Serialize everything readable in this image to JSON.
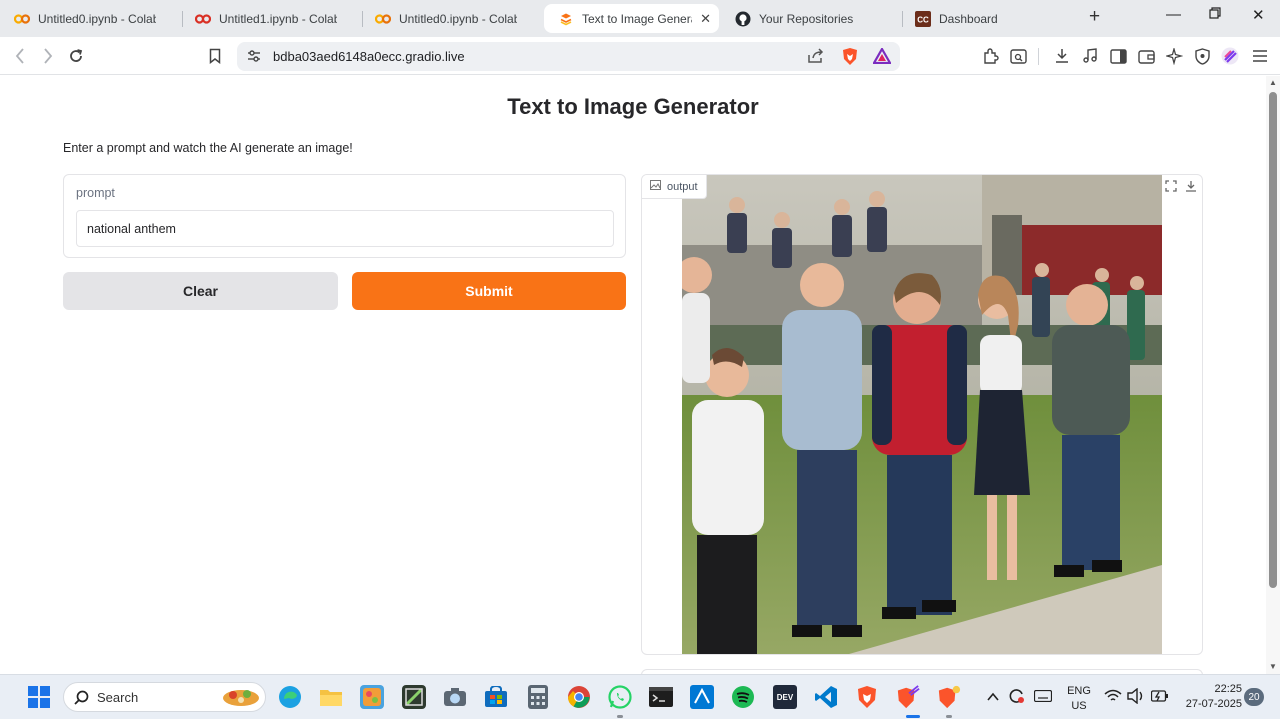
{
  "browser": {
    "tabs": [
      {
        "label": "Untitled0.ipynb - Colab",
        "icon": "colab-icon"
      },
      {
        "label": "Untitled1.ipynb - Colab",
        "icon": "colab-icon"
      },
      {
        "label": "Untitled0.ipynb - Colab",
        "icon": "colab-icon"
      },
      {
        "label": "Text to Image Generat",
        "icon": "gradio-icon",
        "active": true
      },
      {
        "label": "Your Repositories",
        "icon": "github-icon"
      },
      {
        "label": "Dashboard",
        "icon": "cc-icon"
      }
    ],
    "url": "bdba03aed6148a0ecc.gradio.live"
  },
  "app": {
    "title": "Text to Image Generator",
    "description": "Enter a prompt and watch the AI generate an image!",
    "prompt_label": "prompt",
    "prompt_value": "national anthem",
    "clear_label": "Clear",
    "submit_label": "Submit",
    "output_label": "output"
  },
  "taskbar": {
    "search_placeholder": "Search",
    "lang_top": "ENG",
    "lang_bottom": "US",
    "time": "22:25",
    "date": "27-07-2025",
    "notification_count": "20"
  },
  "colors": {
    "accent": "#f97316",
    "clear_button": "#e4e4e7",
    "tabstrip": "#e8eaed"
  }
}
